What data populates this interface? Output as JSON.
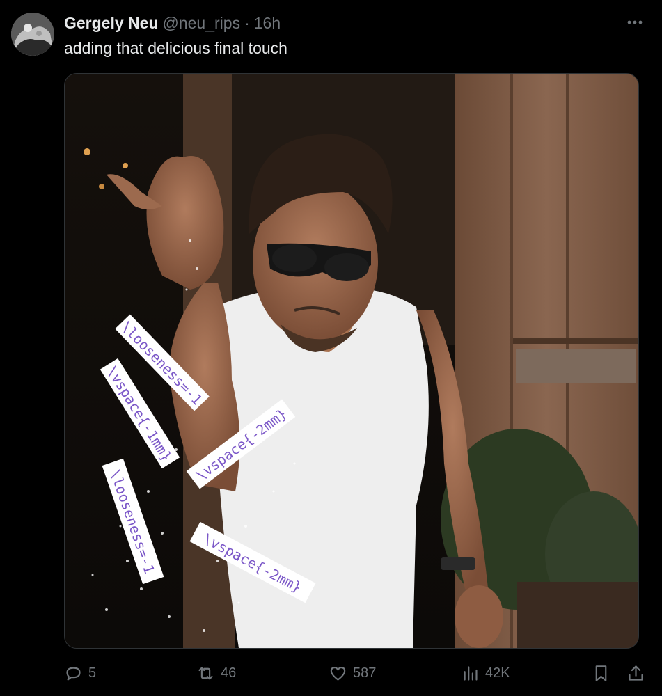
{
  "tweet": {
    "author_name": "Gergely Neu",
    "handle": "@neu_rips",
    "separator": "·",
    "time": "16h",
    "text": "adding that delicious final touch"
  },
  "media": {
    "labels": [
      {
        "text": "\\looseness=-1"
      },
      {
        "text": "\\vspace{-1mm}"
      },
      {
        "text": "\\vspace{-2mm}"
      },
      {
        "text": "\\looseness=-1"
      },
      {
        "text": "\\vspace{-2mm}"
      }
    ],
    "label_color": "#7b57c8"
  },
  "actions": {
    "reply_count": "5",
    "retweet_count": "46",
    "like_count": "587",
    "views_count": "42K"
  },
  "icons": [
    "more-icon",
    "reply-icon",
    "retweet-icon",
    "like-icon",
    "views-icon",
    "bookmark-icon",
    "share-icon"
  ]
}
